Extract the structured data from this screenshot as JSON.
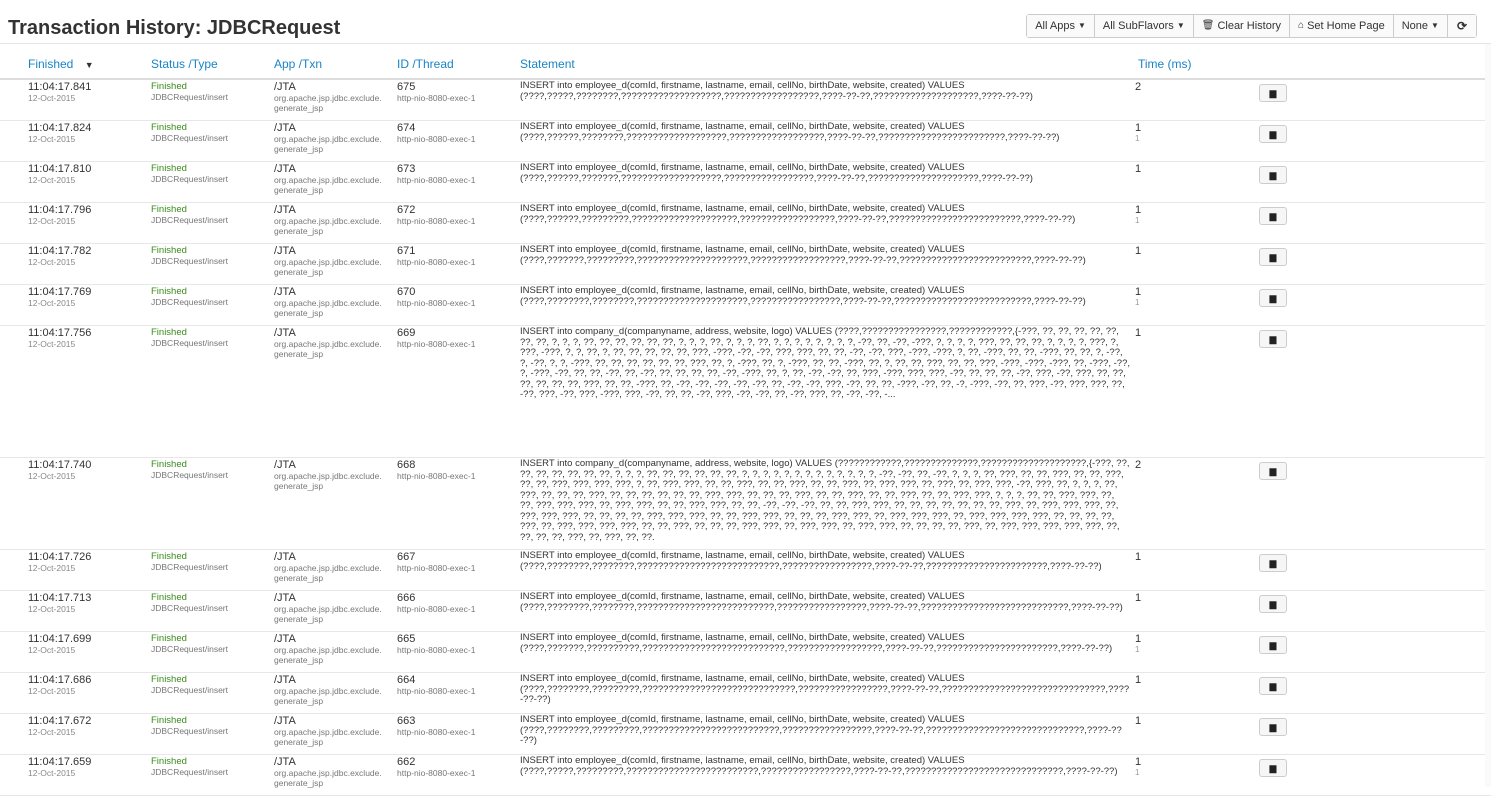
{
  "page": {
    "title": "Transaction History: JDBCRequest"
  },
  "toolbar": {
    "all_apps": "All Apps",
    "all_subflavors": "All SubFlavors",
    "clear_history": "Clear History",
    "set_home_page": "Set Home Page",
    "none": "None"
  },
  "columns": {
    "finished": "Finished",
    "status_type": "Status /Type",
    "app_txn": "App /Txn",
    "id_thread": "ID /Thread",
    "statement": "Statement",
    "time": "Time (ms)"
  },
  "rows": [
    {
      "time": "11:04:17.841",
      "date": "12-Oct-2015",
      "status": "Finished",
      "type": "JDBCRequest/insert",
      "app": "/JTA",
      "txn": "org.apache.jsp.jdbc.exclude.",
      "txn2": "generate_jsp",
      "id": "675",
      "thread": "http-nio-8080-exec-1",
      "statement": "INSERT into employee_d(comId, firstname, lastname, email, cellNo, birthDate, website, created) VALUES (????,?????,????????,???????????????????,??????????????????,????-??-??,????????????????????,????-??-??)",
      "ms": "2",
      "ms2": ""
    },
    {
      "time": "11:04:17.824",
      "date": "12-Oct-2015",
      "status": "Finished",
      "type": "JDBCRequest/insert",
      "app": "/JTA",
      "txn": "org.apache.jsp.jdbc.exclude.",
      "txn2": "generate_jsp",
      "id": "674",
      "thread": "http-nio-8080-exec-1",
      "statement": "INSERT into employee_d(comId, firstname, lastname, email, cellNo, birthDate, website, created) VALUES (????,??????,????????,???????????????????,??????????????????,????-??-??,????????????????????????,????-??-??)",
      "ms": "1",
      "ms2": "1"
    },
    {
      "time": "11:04:17.810",
      "date": "12-Oct-2015",
      "status": "Finished",
      "type": "JDBCRequest/insert",
      "app": "/JTA",
      "txn": "org.apache.jsp.jdbc.exclude.",
      "txn2": "generate_jsp",
      "id": "673",
      "thread": "http-nio-8080-exec-1",
      "statement": "INSERT into employee_d(comId, firstname, lastname, email, cellNo, birthDate, website, created) VALUES (????,??????,???????,???????????????????,?????????????????,????-??-??,?????????????????????,????-??-??)",
      "ms": "1",
      "ms2": ""
    },
    {
      "time": "11:04:17.796",
      "date": "12-Oct-2015",
      "status": "Finished",
      "type": "JDBCRequest/insert",
      "app": "/JTA",
      "txn": "org.apache.jsp.jdbc.exclude.",
      "txn2": "generate_jsp",
      "id": "672",
      "thread": "http-nio-8080-exec-1",
      "statement": "INSERT into employee_d(comId, firstname, lastname, email, cellNo, birthDate, website, created) VALUES (????,??????,?????????,????????????????????,??????????????????,????-??-??,?????????????????????????,????-??-??)",
      "ms": "1",
      "ms2": "1"
    },
    {
      "time": "11:04:17.782",
      "date": "12-Oct-2015",
      "status": "Finished",
      "type": "JDBCRequest/insert",
      "app": "/JTA",
      "txn": "org.apache.jsp.jdbc.exclude.",
      "txn2": "generate_jsp",
      "id": "671",
      "thread": "http-nio-8080-exec-1",
      "statement": "INSERT into employee_d(comId, firstname, lastname, email, cellNo, birthDate, website, created) VALUES (????,???????,?????????,?????????????????????,??????????????????,????-??-??,?????????????????????????,????-??-??)",
      "ms": "1",
      "ms2": ""
    },
    {
      "time": "11:04:17.769",
      "date": "12-Oct-2015",
      "status": "Finished",
      "type": "JDBCRequest/insert",
      "app": "/JTA",
      "txn": "org.apache.jsp.jdbc.exclude.",
      "txn2": "generate_jsp",
      "id": "670",
      "thread": "http-nio-8080-exec-1",
      "statement": "INSERT into employee_d(comId, firstname, lastname, email, cellNo, birthDate, website, created) VALUES (????,????????,????????,?????????????????????,?????????????????,????-??-??,??????????????????????????,????-??-??)",
      "ms": "1",
      "ms2": "1"
    },
    {
      "time": "11:04:17.756",
      "date": "12-Oct-2015",
      "status": "Finished",
      "type": "JDBCRequest/insert",
      "app": "/JTA",
      "txn": "org.apache.jsp.jdbc.exclude.",
      "txn2": "generate_jsp",
      "id": "669",
      "thread": "http-nio-8080-exec-1",
      "statement": "INSERT into company_d(companyname, address, website, logo) VALUES (????,????????????????,????????????,{-???, ??, ??, ??, ??, ??, ??, ??, ?, ?, ?, ??, ??, ??, ??, ??, ??, ?, ?, ?, ??, ?, ?, ?, ??, ?, ?, ?, ?, ?, ?, ?, ?, -??, ??, -??, -???, ?, ?, ?, ?, ???, ??, ??, ??, ?, ?, ?, ?, ???, ?, ???, -???, ?, ?, ??, ?, ??, ??, ??, ??, ??, ???, -???, -??, -??, ???, ???, ??, ??, -??, -??, ???, -???, -???, ?, ??, -???, ??, ??, -???, ??, ??, ?, -??, ?, -??, ?, ?, -???, ??, ??, ??, ??, ??, ??, ???, ??, ?, -???, ??, ?, -???, ??, ??, -???, ??, ?, ??, ??, ???, ??, ??, ???, -???, -???, -???, ??, -???, -??, ?, -???, -??, ??, ??, -??, ??, -??, ??, ??, ??, ??, -??, -???, ??, ?, ??, -??, -??, ??, ???, -???, ???, ???, -??, ??, ??, ??, -??, ???, -??, ???, ??, ??, ??, ??, ??, ??, ???, ??, ??, -???, ??, -??, -??, -??, -??, -??, ??, -??, -??, ???, -??, ??, ??, -???, -??, ??, -?, -???, -??, ??, ???, -??, ???, ???, ??, -??, ???, -??, ???, -???, ???, -??, ??, ??, -??, ???, -??, -??, ??, -??, ???, ??, -??, -??, -...",
      "ms": "1",
      "ms2": ""
    },
    {
      "time": "11:04:17.740",
      "date": "12-Oct-2015",
      "status": "Finished",
      "type": "JDBCRequest/insert",
      "app": "/JTA",
      "txn": "org.apache.jsp.jdbc.exclude.",
      "txn2": "generate_jsp",
      "id": "668",
      "thread": "http-nio-8080-exec-1",
      "statement": "INSERT into company_d(companyname, address, website, logo) VALUES (????????????,??????????????,????????????????????,{-???, ??, ??, ??, ??, ??, ??, ??, ?, ?, ?, ??, ??, ??, ??, ??, ??, ?, ?, ?, ?, ?, ?, ?, ?, ?, ?, ?, ?, ?, -??, -??, ??, -??, ?, ?, ?, ??, ???, ??, ??, ???, ??, ??, ???, ??, ??, ???, ???, ???, ???, ?, ??, ???, ???, ??, ??, ???, ??, ??, ???, ??, ??, ???, ??, ???, ???, ??, ???, ??, ???, ???, -??, ???, ??, ?, ?, ?, ??, ???, ??, ??, ??, ???, ??, ??, ??, ??, ??, ??, ???, ???, ??, ??, ??, ???, ??, ??, ???, ??, ??, ???, ??, ??, ???, ???, ?, ?, ?, ??, ??, ???, ???, ??, ??, ???, ???, ???, ??, ???, ???, ??, ??, ???, ???, ??, ??, -??, -??, -??, ??, ??, ???, ???, ??, ??, ??, ??, ??, ??, ??, ???, ??, ???, ???, ???, ??, ???, ???, ???, ??, ??, ??, ??, ???, ???, ???, ??, ??, ???, ???, ??, ??, ??, ???, ???, ??, ???, ???, ???, ??, ???, ???, ???, ???, ??, ??, ??, ??, ???, ??, ???, ???, ???, ???, ??, ??, ???, ??, ??, ??, ???, ???, ??, ???, ???, ??, ???, ???, ??, ??, ??, ??, ???, ??, ???, ???, ???, ???, ???, ??, ??, ??, ??, ???, ??, ???, ??, ??.",
      "ms": "2",
      "ms2": ""
    },
    {
      "time": "11:04:17.726",
      "date": "12-Oct-2015",
      "status": "Finished",
      "type": "JDBCRequest/insert",
      "app": "/JTA",
      "txn": "org.apache.jsp.jdbc.exclude.",
      "txn2": "generate_jsp",
      "id": "667",
      "thread": "http-nio-8080-exec-1",
      "statement": "INSERT into employee_d(comId, firstname, lastname, email, cellNo, birthDate, website, created) VALUES (????,????????,????????,???????????????????????????,?????????????????,????-??-??,???????????????????????,????-??-??)",
      "ms": "1",
      "ms2": ""
    },
    {
      "time": "11:04:17.713",
      "date": "12-Oct-2015",
      "status": "Finished",
      "type": "JDBCRequest/insert",
      "app": "/JTA",
      "txn": "org.apache.jsp.jdbc.exclude.",
      "txn2": "generate_jsp",
      "id": "666",
      "thread": "http-nio-8080-exec-1",
      "statement": "INSERT into employee_d(comId, firstname, lastname, email, cellNo, birthDate, website, created) VALUES (????,????????,????????,??????????????????????????,?????????????????,????-??-??,????????????????????????????,????-??-??)",
      "ms": "1",
      "ms2": ""
    },
    {
      "time": "11:04:17.699",
      "date": "12-Oct-2015",
      "status": "Finished",
      "type": "JDBCRequest/insert",
      "app": "/JTA",
      "txn": "org.apache.jsp.jdbc.exclude.",
      "txn2": "generate_jsp",
      "id": "665",
      "thread": "http-nio-8080-exec-1",
      "statement": "INSERT into employee_d(comId, firstname, lastname, email, cellNo, birthDate, website, created) VALUES (????,???????,??????????,???????????????????????????,??????????????????,????-??-??,???????????????????????,????-??-??)",
      "ms": "1",
      "ms2": "1"
    },
    {
      "time": "11:04:17.686",
      "date": "12-Oct-2015",
      "status": "Finished",
      "type": "JDBCRequest/insert",
      "app": "/JTA",
      "txn": "org.apache.jsp.jdbc.exclude.",
      "txn2": "generate_jsp",
      "id": "664",
      "thread": "http-nio-8080-exec-1",
      "statement": "INSERT into employee_d(comId, firstname, lastname, email, cellNo, birthDate, website, created) VALUES (????,????????,?????????,?????????????????????????????,?????????????????,????-??-??,???????????????????????????????,????-??-??)",
      "ms": "1",
      "ms2": ""
    },
    {
      "time": "11:04:17.672",
      "date": "12-Oct-2015",
      "status": "Finished",
      "type": "JDBCRequest/insert",
      "app": "/JTA",
      "txn": "org.apache.jsp.jdbc.exclude.",
      "txn2": "generate_jsp",
      "id": "663",
      "thread": "http-nio-8080-exec-1",
      "statement": "INSERT into employee_d(comId, firstname, lastname, email, cellNo, birthDate, website, created) VALUES (????,????????,?????????,??????????????????????????,?????????????????,????-??-??,??????????????????????????????,????-??-??)",
      "ms": "1",
      "ms2": ""
    },
    {
      "time": "11:04:17.659",
      "date": "12-Oct-2015",
      "status": "Finished",
      "type": "JDBCRequest/insert",
      "app": "/JTA",
      "txn": "org.apache.jsp.jdbc.exclude.",
      "txn2": "generate_jsp",
      "id": "662",
      "thread": "http-nio-8080-exec-1",
      "statement": "INSERT into employee_d(comId, firstname, lastname, email, cellNo, birthDate, website, created) VALUES (????,?????,?????????,?????????????????????????,?????????????????,????-??-??,??????????????????????????????,????-??-??)",
      "ms": "1",
      "ms2": "1"
    }
  ]
}
